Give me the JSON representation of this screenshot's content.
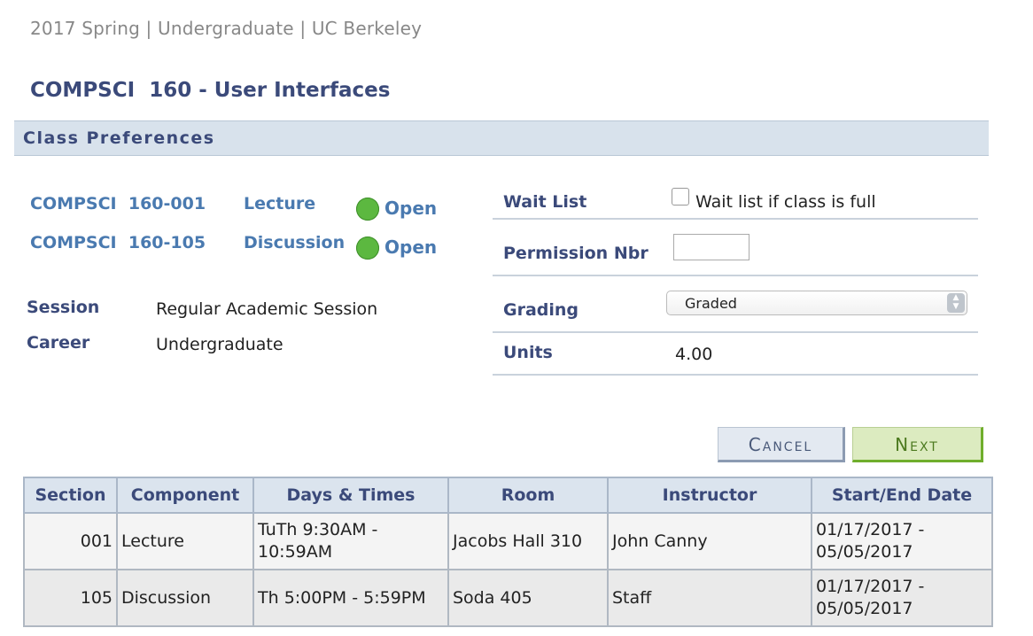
{
  "breadcrumb": "2017 Spring | Undergraduate | UC Berkeley",
  "course_title": "COMPSCI  160 - User Interfaces",
  "section_header": "Class Preferences",
  "classes": [
    {
      "id": "COMPSCI  160-001",
      "component": "Lecture",
      "status": "Open"
    },
    {
      "id": "COMPSCI  160-105",
      "component": "Discussion",
      "status": "Open"
    }
  ],
  "info": {
    "session_label": "Session",
    "session_value": "Regular Academic Session",
    "career_label": "Career",
    "career_value": "Undergraduate"
  },
  "form": {
    "waitlist_label": "Wait List",
    "waitlist_checkbox_text": "Wait list if class is full",
    "waitlist_checked": false,
    "permission_label": "Permission Nbr",
    "permission_value": "",
    "grading_label": "Grading",
    "grading_value": "Graded",
    "units_label": "Units",
    "units_value": "4.00"
  },
  "buttons": {
    "cancel": "Cancel",
    "next": "Next"
  },
  "table": {
    "headers": [
      "Section",
      "Component",
      "Days & Times",
      "Room",
      "Instructor",
      "Start/End Date"
    ],
    "rows": [
      {
        "section": "001",
        "component": "Lecture",
        "days_times": "TuTh 9:30AM - 10:59AM",
        "room": "Jacobs Hall 310",
        "instructor": "John Canny",
        "dates": "01/17/2017 - 05/05/2017"
      },
      {
        "section": "105",
        "component": "Discussion",
        "days_times": "Th 5:00PM - 5:59PM",
        "room": "Soda 405",
        "instructor": "Staff",
        "dates": "01/17/2017 - 05/05/2017"
      }
    ]
  },
  "colors": {
    "title": "#3b4a7a",
    "link": "#4a7ab0",
    "open_status": "#5cb840",
    "header_bg": "#d8e2ec",
    "next_button": "#dcebc0"
  },
  "icons": {
    "open_status": "green-circle-icon",
    "select_arrows": "up-down-chevron-icon"
  }
}
